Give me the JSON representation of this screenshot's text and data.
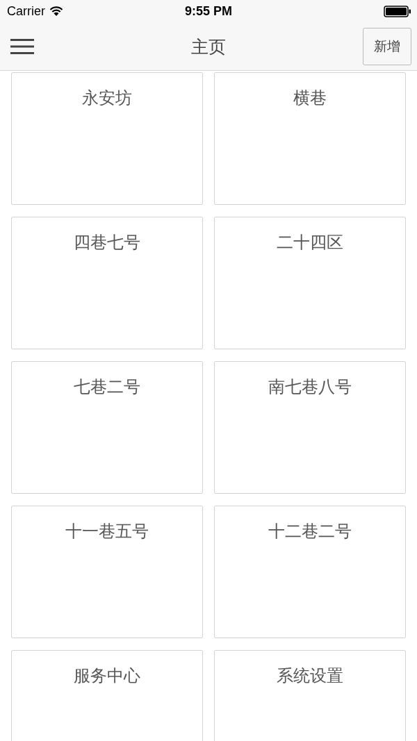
{
  "status_bar": {
    "carrier": "Carrier",
    "time": "9:55 PM"
  },
  "nav_bar": {
    "title": "主页",
    "add_button": "新增"
  },
  "tiles": [
    {
      "label": "永安坊"
    },
    {
      "label": "横巷"
    },
    {
      "label": "四巷七号"
    },
    {
      "label": "二十四区"
    },
    {
      "label": "七巷二号"
    },
    {
      "label": "南七巷八号"
    },
    {
      "label": "十一巷五号"
    },
    {
      "label": "十二巷二号"
    },
    {
      "label": "服务中心"
    },
    {
      "label": "系统设置"
    }
  ]
}
